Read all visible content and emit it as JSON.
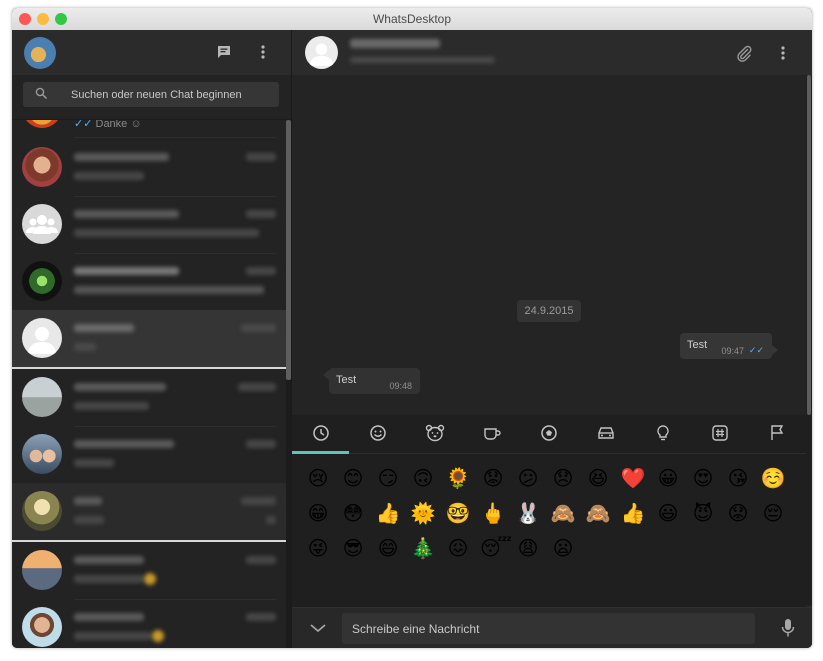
{
  "window": {
    "title": "WhatsDesktop"
  },
  "sidebar": {
    "icons": {
      "new_chat": "chat-icon",
      "menu": "more-vert-icon"
    },
    "search": {
      "placeholder": "Suchen oder neuen Chat beginnen",
      "icon": "search-icon"
    },
    "partial_preview": {
      "tick": "✓✓",
      "text": "Danke ☺"
    }
  },
  "conversation": {
    "date": "24.9.2015",
    "messages": [
      {
        "direction": "out",
        "text": "Test",
        "time": "09:47",
        "status": "✓✓"
      },
      {
        "direction": "in",
        "text": "Test",
        "time": "09:48"
      }
    ]
  },
  "emoji_tabs": [
    "clock-icon",
    "smiley-icon",
    "bear-icon",
    "cup-icon",
    "soccer-ball-icon",
    "car-icon",
    "lightbulb-icon",
    "hash-icon",
    "flag-icon"
  ],
  "emojis": [
    [
      "😢",
      "😊",
      "😏",
      "🙃",
      "🌻",
      "😟",
      "😕",
      "😞",
      "😆",
      "❤️",
      "😀",
      "😍",
      "😘",
      "☺️"
    ],
    [
      "😁",
      "😳",
      "👍",
      "🌞",
      "🤓",
      "🖕",
      "🐰",
      "🙈",
      "🙈",
      "👍",
      "😃",
      "😈",
      "😟",
      "😔"
    ],
    [
      "😜",
      "😎",
      "😄",
      "🎄",
      "😖",
      "😴",
      "😩",
      "😦"
    ]
  ],
  "composer": {
    "placeholder": "Schreibe eine Nachricht",
    "expand_icon": "chevron-down-icon",
    "mic_icon": "mic-icon"
  },
  "colors": {
    "accent": "#5bc6b4",
    "read_tick": "#4fb3f6",
    "background": "#262626"
  }
}
